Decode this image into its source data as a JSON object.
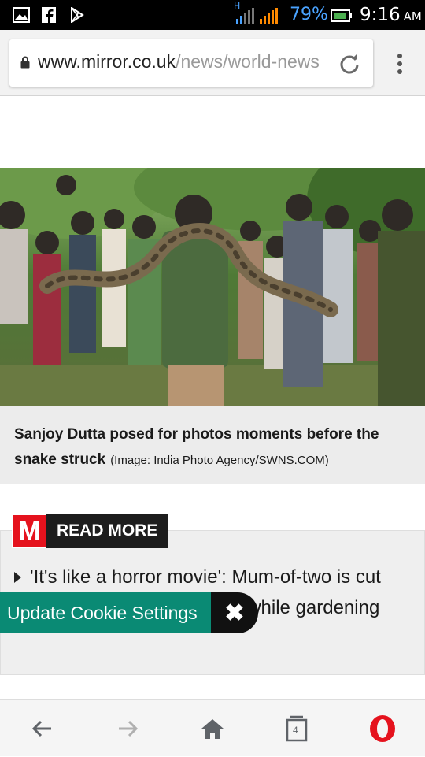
{
  "status_bar": {
    "signal_label": "H",
    "battery_percent": "79%",
    "time": "9:16",
    "ampm": "AM",
    "icons": [
      "image-icon",
      "facebook-icon",
      "play-store-icon",
      "signal-icon",
      "battery-icon"
    ]
  },
  "browser": {
    "url_domain": "www.mirror.co.uk",
    "url_path": "/news/world-news",
    "reload_icon": "reload-icon",
    "menu_icon": "more-vert-icon"
  },
  "article": {
    "image_description_icon": "article-photo",
    "caption_main": "Sanjoy Dutta posed for photos moments before the snake struck",
    "caption_credit": "(Image: India Photo Agency/SWNS.COM)"
  },
  "read_more": {
    "logo_letter": "M",
    "label": "READ MORE",
    "headline": "'It's like a horror movie': Mum-of-two is cut open after she was eaten while gardening"
  },
  "cookie": {
    "label": "Update Cookie Settings",
    "close_glyph": "✖"
  },
  "bottom_nav": {
    "tab_count": "4",
    "colors": {
      "opera_red": "#e5121d",
      "icon_gray": "#5f6368",
      "disabled_gray": "#b0b0b0"
    }
  }
}
